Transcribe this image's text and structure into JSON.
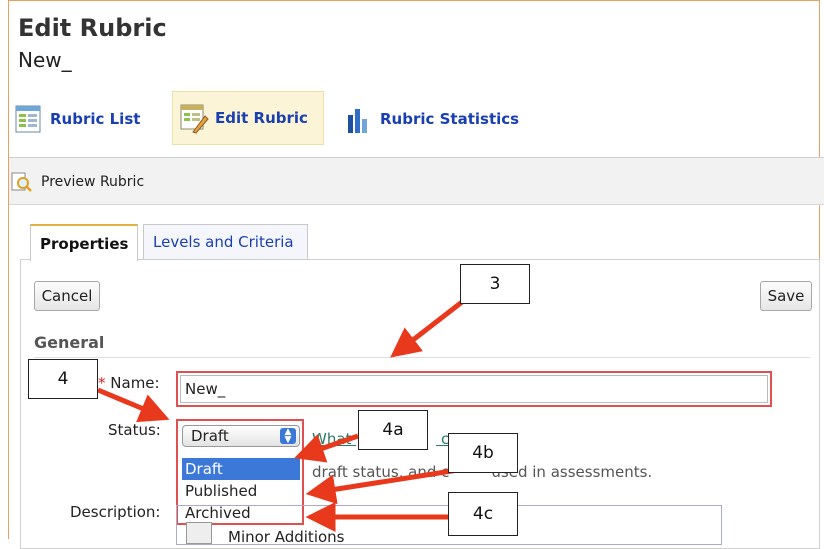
{
  "header": {
    "title": "Edit Rubric",
    "subtitle": "New_"
  },
  "nav": {
    "items": [
      {
        "label": "Rubric List",
        "icon": "rubric-list-icon"
      },
      {
        "label": "Edit Rubric",
        "icon": "edit-rubric-icon",
        "selected": true
      },
      {
        "label": "Rubric Statistics",
        "icon": "bar-chart-icon"
      }
    ]
  },
  "actions": {
    "preview_label": "Preview Rubric"
  },
  "tabs": [
    {
      "label": "Properties",
      "active": true
    },
    {
      "label": "Levels and Criteria",
      "active": false
    }
  ],
  "buttons": {
    "cancel": "Cancel",
    "save": "Save"
  },
  "section": {
    "general": "General"
  },
  "form": {
    "name_required": "*",
    "name_label": "Name:",
    "name_value": "New_",
    "status_label": "Status:",
    "status_selected": "Draft",
    "status_options": [
      "Draft",
      "Published",
      "Archived"
    ],
    "help_link_visible": "What",
    "help_link_tail": "c s",
    "help_text_a": "draft status",
    "help_text_b": ", and c",
    "help_text_c": "used in assessments.",
    "description_label": "Description:",
    "description_text": "Minor Additions"
  },
  "callouts": [
    "3",
    "4",
    "4a",
    "4b",
    "4c"
  ],
  "colors": {
    "accent": "#1a3fb0",
    "arrow": "#e8391d",
    "highlight": "#3b78d8",
    "selected_tab_bg": "#fbf4d6"
  }
}
